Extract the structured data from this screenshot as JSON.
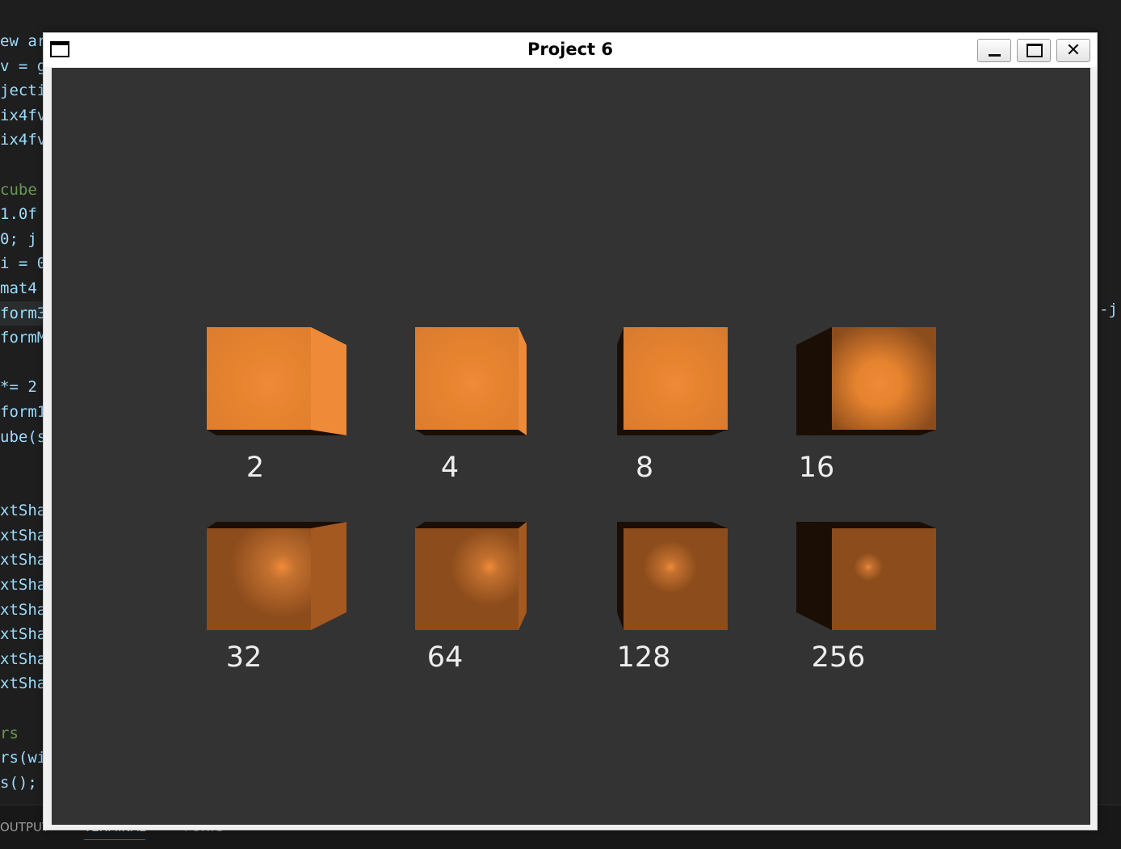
{
  "editor": {
    "code_lines": [
      {
        "text": "ew ar",
        "kind": "code"
      },
      {
        "text": "v = g",
        "kind": "code"
      },
      {
        "text": "jecti",
        "kind": "code"
      },
      {
        "text": "ix4fv",
        "kind": "code"
      },
      {
        "text": "ix4fv",
        "kind": "code"
      },
      {
        "text": "",
        "kind": "code"
      },
      {
        "text": " cube",
        "kind": "comment"
      },
      {
        "text": " 1.0f",
        "kind": "code"
      },
      {
        "text": "0; j",
        "kind": "code"
      },
      {
        "text": "i = 0",
        "kind": "code"
      },
      {
        "text": "mat4",
        "kind": "code"
      },
      {
        "text": "form3",
        "kind": "hl"
      },
      {
        "text": "formM",
        "kind": "code"
      },
      {
        "text": "",
        "kind": "code"
      },
      {
        "text": " *= 2",
        "kind": "code"
      },
      {
        "text": "form1",
        "kind": "code"
      },
      {
        "text": "ube(s",
        "kind": "code"
      },
      {
        "text": "",
        "kind": "code"
      },
      {
        "text": "",
        "kind": "code"
      },
      {
        "text": "xtSha",
        "kind": "code"
      },
      {
        "text": "xtSha",
        "kind": "code"
      },
      {
        "text": "xtSha",
        "kind": "code"
      },
      {
        "text": "xtSha",
        "kind": "code"
      },
      {
        "text": "xtSha",
        "kind": "code"
      },
      {
        "text": "xtSha",
        "kind": "code"
      },
      {
        "text": "xtSha",
        "kind": "code"
      },
      {
        "text": "xtSha",
        "kind": "code"
      },
      {
        "text": "",
        "kind": "code"
      },
      {
        "text": "rs",
        "kind": "comment"
      },
      {
        "text": "rs(wi",
        "kind": "code"
      },
      {
        "text": "s();",
        "kind": "code"
      }
    ],
    "right_fragment": "-j",
    "panel_tabs": {
      "output": "OUTPUT",
      "terminal": "TERMINAL",
      "ports": "PORTS"
    }
  },
  "window": {
    "title": "Project 6",
    "buttons": {
      "minimize": "minimize-icon",
      "maximize": "maximize-icon",
      "close": "close-icon"
    }
  },
  "cubes": [
    {
      "label": "2",
      "shininess": 2
    },
    {
      "label": "4",
      "shininess": 4
    },
    {
      "label": "8",
      "shininess": 8
    },
    {
      "label": "16",
      "shininess": 16
    },
    {
      "label": "32",
      "shininess": 32
    },
    {
      "label": "64",
      "shininess": 64
    },
    {
      "label": "128",
      "shininess": 128
    },
    {
      "label": "256",
      "shininess": 256
    }
  ],
  "colors": {
    "cube_face": "#8c4c1c",
    "cube_highlight": "#ef8a38",
    "cube_dark": "#1a0e05",
    "canvas_bg": "#333333"
  }
}
